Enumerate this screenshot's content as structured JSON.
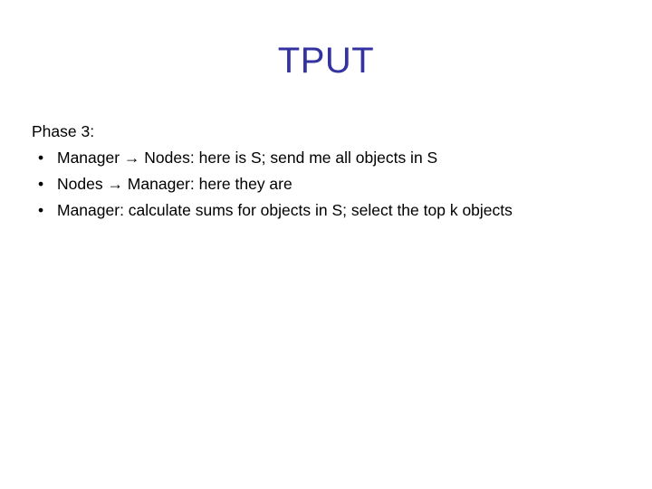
{
  "slide": {
    "title": "TPUT",
    "title_color": "#3333a0",
    "background_color": "#ffffff",
    "body_color": "#000000",
    "lead_line": "Phase 3:",
    "bullet_marker": "•",
    "bullets": [
      {
        "text": "Manager → Nodes: here is S; send me all objects in S"
      },
      {
        "text": "Nodes → Manager: here they are"
      },
      {
        "text": "Manager: calculate sums for objects in S; select the top k objects"
      }
    ]
  }
}
